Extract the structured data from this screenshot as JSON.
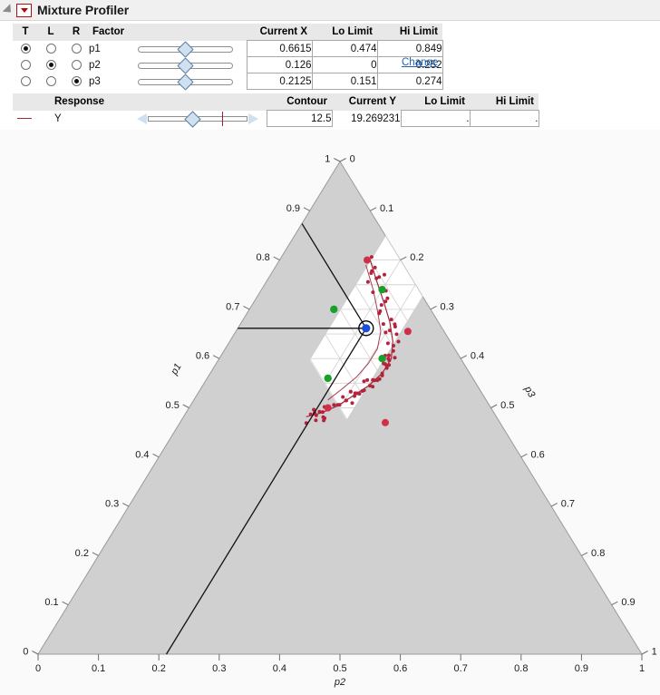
{
  "window": {
    "title": "Mixture Profiler",
    "disclosure_icon": "triangle-collapse-icon",
    "menu_icon": "red-triangle-menu-icon"
  },
  "factor_table": {
    "headers": {
      "t": "T",
      "l": "L",
      "r": "R",
      "factor": "Factor",
      "slider": "",
      "current_x": "Current X",
      "lo_limit": "Lo Limit",
      "hi_limit": "Hi Limit"
    },
    "rows": [
      {
        "t": true,
        "l": false,
        "r": false,
        "name": "p1",
        "slider_pct": 49,
        "current_x": "0.6615",
        "lo_limit": "0.474",
        "hi_limit": "0.849"
      },
      {
        "t": false,
        "l": true,
        "r": false,
        "name": "p2",
        "slider_pct": 49,
        "current_x": "0.126",
        "lo_limit": "0",
        "hi_limit": "0.252"
      },
      {
        "t": false,
        "l": false,
        "r": true,
        "name": "p3",
        "slider_pct": 49,
        "current_x": "0.2125",
        "lo_limit": "0.151",
        "hi_limit": "0.274"
      }
    ],
    "change_link": "Change"
  },
  "response_table": {
    "headers": {
      "response": "Response",
      "slider": "",
      "contour": "Contour",
      "current_y": "Current Y",
      "lo_limit": "Lo Limit",
      "hi_limit": "Hi Limit"
    },
    "rows": [
      {
        "name": "Y",
        "legend_color": "#9c2a3c",
        "slider_pct": 45,
        "redtick_pct": 68,
        "contour": "12.5",
        "current_y": "19.269231",
        "lo_limit": ".",
        "hi_limit": "."
      }
    ]
  },
  "chart_data": {
    "type": "ternary",
    "title": "",
    "axes": [
      {
        "name": "p1",
        "position": "left",
        "direction": "bottom-to-top",
        "ticks": [
          0,
          0.1,
          0.2,
          0.3,
          0.4,
          0.5,
          0.6,
          0.7,
          0.8,
          0.9,
          1
        ],
        "tick_labels": [
          "0",
          "0.1",
          "0.2",
          "0.3",
          "0.4",
          "0.5",
          "0.6",
          "0.7",
          "0.8",
          "0.9",
          "1"
        ]
      },
      {
        "name": "p2",
        "position": "bottom",
        "direction": "right-to-left",
        "ticks": [
          0,
          0.1,
          0.2,
          0.3,
          0.4,
          0.5,
          0.6,
          0.7,
          0.8,
          0.9,
          1
        ],
        "tick_labels": [
          "1",
          "0.9",
          "0.8",
          "0.7",
          "0.6",
          "0.5",
          "0.4",
          "0.3",
          "0.2",
          "0.1",
          "0"
        ]
      },
      {
        "name": "p3",
        "position": "right",
        "direction": "top-to-bottom",
        "ticks": [
          0,
          0.1,
          0.2,
          0.3,
          0.4,
          0.5,
          0.6,
          0.7,
          0.8,
          0.9,
          1
        ],
        "tick_labels": [
          "0",
          "0.1",
          "0.2",
          "0.3",
          "0.4",
          "0.5",
          "0.6",
          "0.7",
          "0.8",
          "0.9",
          "1"
        ]
      }
    ],
    "constraint_region": {
      "description": "feasible white parallelogram defined by factor lo/hi limits",
      "p1_range": [
        0.474,
        0.849
      ],
      "p2_range": [
        0.0,
        0.252
      ],
      "p3_range": [
        0.151,
        0.274
      ],
      "fill": "#ffffff",
      "outside_fill": "#d0d0d0"
    },
    "current_point": {
      "p1": 0.6615,
      "p2": 0.126,
      "p3": 0.2125,
      "color": "#1a4fd8",
      "outline": "#000000"
    },
    "contour": {
      "label": "Y",
      "value": 12.5,
      "color": "#9c2a3c"
    },
    "green_points": [
      {
        "p1": 0.74,
        "p2": 0.06,
        "p3": 0.2
      },
      {
        "p1": 0.7,
        "p2": 0.16,
        "p3": 0.14
      },
      {
        "p1": 0.6,
        "p2": 0.13,
        "p3": 0.27
      },
      {
        "p1": 0.56,
        "p2": 0.24,
        "p3": 0.2
      }
    ],
    "red_points_outer": [
      {
        "p1": 0.8,
        "p2": 0.055,
        "p3": 0.145
      },
      {
        "p1": 0.655,
        "p2": 0.06,
        "p3": 0.285
      },
      {
        "p1": 0.5,
        "p2": 0.27,
        "p3": 0.23
      },
      {
        "p1": 0.47,
        "p2": 0.19,
        "p3": 0.34
      }
    ],
    "red_sample_count": 62,
    "grid": true,
    "legend_position": "none"
  }
}
